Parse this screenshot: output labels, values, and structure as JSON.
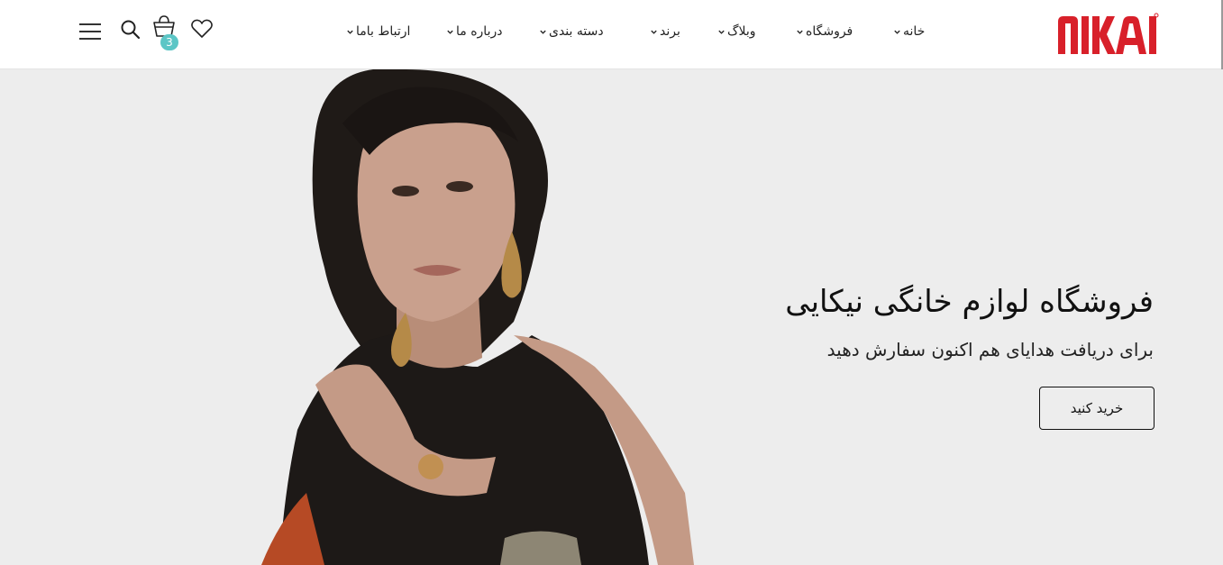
{
  "brand": {
    "logo_text": "NIKAI",
    "color": "#d8202a"
  },
  "nav": {
    "items": [
      {
        "label": "خانه"
      },
      {
        "label": "فروشگاه"
      },
      {
        "label": "وبلاگ"
      },
      {
        "label": "برند"
      },
      {
        "label": "دسته بندی"
      },
      {
        "label": "درباره ما"
      },
      {
        "label": "ارتباط باما"
      }
    ]
  },
  "tools": {
    "icons": [
      "heart-icon",
      "cart-icon",
      "search-icon",
      "menu-icon"
    ],
    "cart_count": "3",
    "badge_color": "#5cc6c6"
  },
  "hero": {
    "title": "فروشگاه لوازم خانگی نیکایی",
    "subtitle": "برای دریافت هدایای هم اکنون سفارش دهید",
    "cta_label": "خرید کنید",
    "background": "#ededed"
  }
}
